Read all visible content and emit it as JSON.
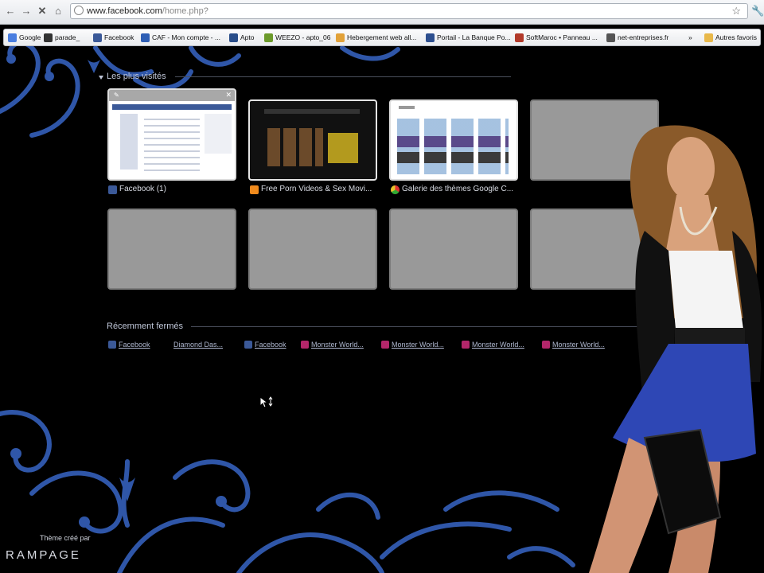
{
  "browser": {
    "url_host": "www.facebook.com",
    "url_path": "/home.php?"
  },
  "bookmarks": [
    {
      "label": "Google",
      "icon": "google-icon",
      "color": "#4a7ee0"
    },
    {
      "label": "parade_",
      "icon": "parade-icon",
      "color": "#333333"
    },
    {
      "label": "Facebook",
      "icon": "facebook-icon",
      "color": "#3b5998"
    },
    {
      "label": "CAF - Mon compte - ...",
      "icon": "caf-icon",
      "color": "#2f5fb5"
    },
    {
      "label": "Apto",
      "icon": "apto-icon",
      "color": "#2a4e8a"
    },
    {
      "label": "WEEZO - apto_06",
      "icon": "weezo-icon",
      "color": "#6c9a2b"
    },
    {
      "label": "Hebergement web all...",
      "icon": "hosting-icon",
      "color": "#e2a23a"
    },
    {
      "label": "Portail - La Banque Po...",
      "icon": "bank-icon",
      "color": "#2d4f8f"
    },
    {
      "label": "SoftMaroc • Panneau ...",
      "icon": "softmaroc-icon",
      "color": "#b23a2a"
    },
    {
      "label": "net-entreprises.fr",
      "icon": "globe-icon",
      "color": "#555555"
    },
    {
      "label": "»",
      "icon": "chevron-right-icon",
      "color": "#333333"
    },
    {
      "label": "Autres favoris",
      "icon": "folder-icon",
      "color": "#e8b84a"
    }
  ],
  "most_visited": {
    "title": "Les plus visités",
    "tiles": [
      {
        "label": "Facebook (1)",
        "icon": "facebook-icon",
        "color": "#3b5998"
      },
      {
        "label": "Free Porn Videos & Sex Movi...",
        "icon": "ph-icon",
        "color": "#f08a1c"
      },
      {
        "label": "Galerie des thèmes Google C...",
        "icon": "chrome-icon",
        "color": "#e8a22a"
      }
    ]
  },
  "recently_closed": {
    "title": "Récemment fermés",
    "items": [
      {
        "label": "Facebook",
        "icon": "facebook-icon"
      },
      {
        "label": "Diamond Das...",
        "icon": ""
      },
      {
        "label": "Facebook",
        "icon": "facebook-icon"
      },
      {
        "label": "Monster World...",
        "icon": "monster-world-icon"
      },
      {
        "label": "Monster World...",
        "icon": "monster-world-icon"
      },
      {
        "label": "Monster World...",
        "icon": "monster-world-icon"
      },
      {
        "label": "Monster World...",
        "icon": "monster-world-icon"
      }
    ]
  },
  "theme_credit": {
    "line1": "Thème créé par",
    "line2": "RAMPAGE"
  },
  "colors": {
    "background": "#000000",
    "swirl": "#2f56a8",
    "facebook": "#3b5998",
    "monster_world": "#b3266a"
  }
}
